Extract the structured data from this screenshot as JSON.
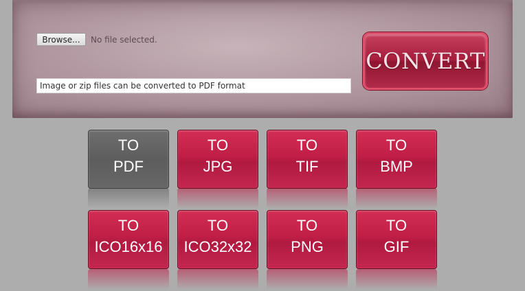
{
  "upload": {
    "browse_label": "Browse...",
    "file_status": "No file selected.",
    "hint_placeholder": "Image or zip files can be converted to PDF format"
  },
  "convert": {
    "label": "CONVERT"
  },
  "formats": [
    {
      "prefix": "TO",
      "target": "PDF",
      "selected": true
    },
    {
      "prefix": "TO",
      "target": "JPG",
      "selected": false
    },
    {
      "prefix": "TO",
      "target": "TIF",
      "selected": false
    },
    {
      "prefix": "TO",
      "target": "BMP",
      "selected": false
    },
    {
      "prefix": "TO",
      "target": "ICO16x16",
      "selected": false
    },
    {
      "prefix": "TO",
      "target": "ICO32x32",
      "selected": false
    },
    {
      "prefix": "TO",
      "target": "PNG",
      "selected": false
    },
    {
      "prefix": "TO",
      "target": "GIF",
      "selected": false
    }
  ],
  "colors": {
    "accent": "#c01e46",
    "selected": "#636363",
    "background": "#adadad"
  }
}
